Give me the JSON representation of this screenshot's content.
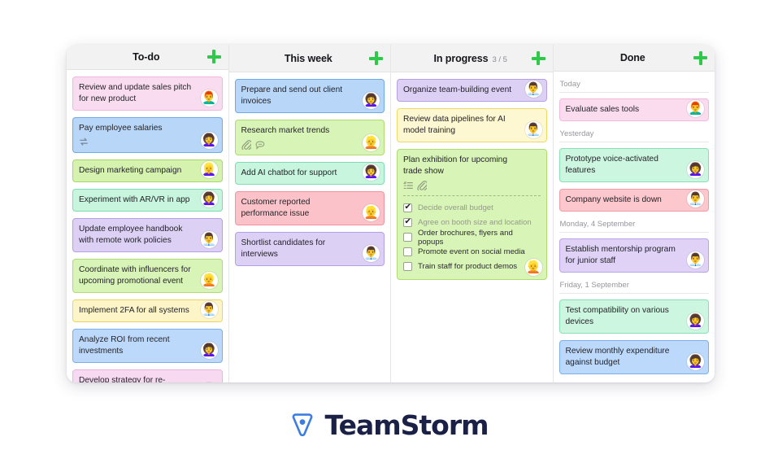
{
  "brand": {
    "name": "TeamStorm",
    "mark_icon": "location-pin-triangle-icon",
    "mark_color": "#3b7de0",
    "text_color": "#1b2047"
  },
  "board": {
    "add_icon": "plus-icon",
    "accent_add": "#2ec94a",
    "columns": [
      {
        "id": "todo",
        "title": "To-do",
        "count": "",
        "cards": [
          {
            "title": "Review and update sales pitch for new product",
            "color": "c-pink",
            "avatar": "👨‍🦰",
            "icons": []
          },
          {
            "title": "Pay employee salaries",
            "color": "c-blue",
            "avatar": "👩‍🦱",
            "icons": [
              "repeat-icon"
            ]
          },
          {
            "title": "Design marketing campaign",
            "color": "c-green",
            "avatar": "👱‍♀️",
            "icons": []
          },
          {
            "title": "Experiment with AR/VR in app",
            "color": "c-mint",
            "avatar": "👩‍🦱",
            "icons": []
          },
          {
            "title": "Update employee handbook with remote work policies",
            "color": "c-purple",
            "avatar": "👨‍💼",
            "icons": []
          },
          {
            "title": "Coordinate with influencers for upcoming promotional event",
            "color": "c-lgreen",
            "avatar": "👱",
            "icons": []
          },
          {
            "title": "Implement 2FA for all systems",
            "color": "c-yellow",
            "avatar": "👨‍💼",
            "icons": []
          },
          {
            "title": "Analyze ROI from recent investments",
            "color": "c-blue2",
            "avatar": "👩‍🦱",
            "icons": []
          },
          {
            "title": "Develop strategy for re-engaging past customers",
            "color": "c-ppink",
            "avatar": "👨‍🦰",
            "icons": []
          }
        ]
      },
      {
        "id": "this-week",
        "title": "This week",
        "count": "",
        "cards": [
          {
            "title": "Prepare and send out client invoices",
            "color": "c-blue",
            "avatar": "👩‍🦱",
            "icons": []
          },
          {
            "title": "Research market trends",
            "color": "c-lgreen",
            "avatar": "👱",
            "icons": [
              "paperclip-icon",
              "comment-icon"
            ]
          },
          {
            "title": "Add AI chatbot for support",
            "color": "c-mint",
            "avatar": "👩‍🦱",
            "icons": []
          },
          {
            "title": "Customer reported performance issue",
            "color": "c-red",
            "avatar": "👱",
            "icons": []
          },
          {
            "title": "Shortlist candidates for interviews",
            "color": "c-purple",
            "avatar": "👨‍💼",
            "icons": []
          }
        ]
      },
      {
        "id": "in-progress",
        "title": "In progress",
        "count": "3 / 5",
        "cards": [
          {
            "title": "Organize team-building event",
            "color": "c-purple",
            "avatar": "👨‍💼",
            "icons": []
          },
          {
            "title": "Review data pipelines for AI model training",
            "color": "c-lyellow",
            "avatar": "👨‍💼",
            "icons": []
          },
          {
            "title": "Plan exhibition for upcoming trade show",
            "color": "c-lgreen",
            "avatar": "👱",
            "icons": [
              "checklist-icon",
              "paperclip-icon"
            ],
            "checklist": [
              {
                "label": "Decide overall budget",
                "checked": true
              },
              {
                "label": "Agree on booth size and location",
                "checked": true
              },
              {
                "label": "Order brochures, flyers and popups",
                "checked": false
              },
              {
                "label": "Promote event on social media",
                "checked": false
              },
              {
                "label": "Train staff for product demos",
                "checked": false
              }
            ]
          }
        ]
      },
      {
        "id": "done",
        "title": "Done",
        "count": "",
        "groups": [
          {
            "date": "Today",
            "cards": [
              {
                "title": "Evaluate sales tools",
                "color": "c-lpink",
                "avatar": "👨‍🦰",
                "icons": []
              }
            ]
          },
          {
            "date": "Yesterday",
            "cards": [
              {
                "title": "Prototype voice-activated features",
                "color": "c-lmint",
                "avatar": "👩‍🦱",
                "icons": []
              },
              {
                "title": "Company website is down",
                "color": "c-lred",
                "avatar": "👨‍💼",
                "icons": []
              }
            ]
          },
          {
            "date": "Monday, 4 September",
            "cards": [
              {
                "title": "Establish mentorship program for junior staff",
                "color": "c-lpurple",
                "avatar": "👨‍💼",
                "icons": []
              }
            ]
          },
          {
            "date": "Friday, 1 September",
            "cards": [
              {
                "title": "Test compatibility on various devices",
                "color": "c-lmint",
                "avatar": "👩‍🦱",
                "icons": []
              },
              {
                "title": "Review monthly expenditure against budget",
                "color": "c-lblue",
                "avatar": "👩‍🦱",
                "icons": []
              }
            ]
          }
        ]
      }
    ]
  }
}
